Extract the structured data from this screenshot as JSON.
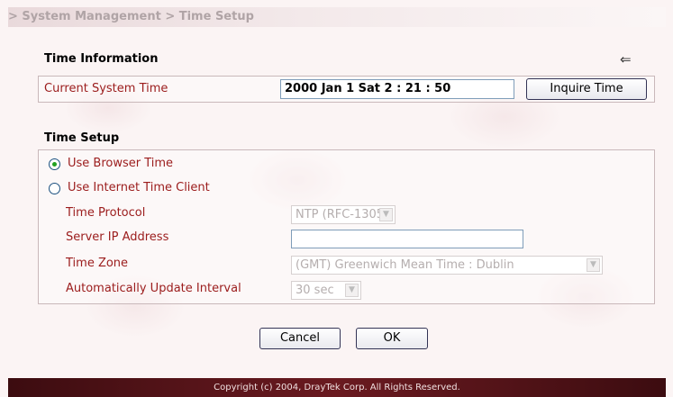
{
  "breadcrumb": "> System Management > Time Setup",
  "time_information": {
    "title": "Time Information",
    "back_icon": "back-arrow-icon",
    "current_time_label": "Current System Time",
    "current_time_value": "2000 Jan 1 Sat 2 : 21 : 50",
    "inquire_button": "Inquire Time"
  },
  "time_setup": {
    "title": "Time Setup",
    "options": {
      "browser": {
        "label": "Use Browser Time",
        "checked": true
      },
      "internet": {
        "label": "Use Internet Time Client",
        "checked": false
      }
    },
    "protocol_label": "Time Protocol",
    "protocol_value": "NTP (RFC-1305)",
    "server_label": "Server IP Address",
    "server_value": "",
    "zone_label": "Time Zone",
    "zone_value": "(GMT) Greenwich Mean Time : Dublin",
    "interval_label": "Automatically Update Interval",
    "interval_value": "30 sec"
  },
  "actions": {
    "cancel": "Cancel",
    "ok": "OK"
  },
  "footer": "Copyright (c) 2004, DrayTek Corp. All Rights Reserved.",
  "colors": {
    "label_red": "#9b1c1c",
    "radio_selected": "#21a121",
    "footer_bg": "#5a1418"
  }
}
